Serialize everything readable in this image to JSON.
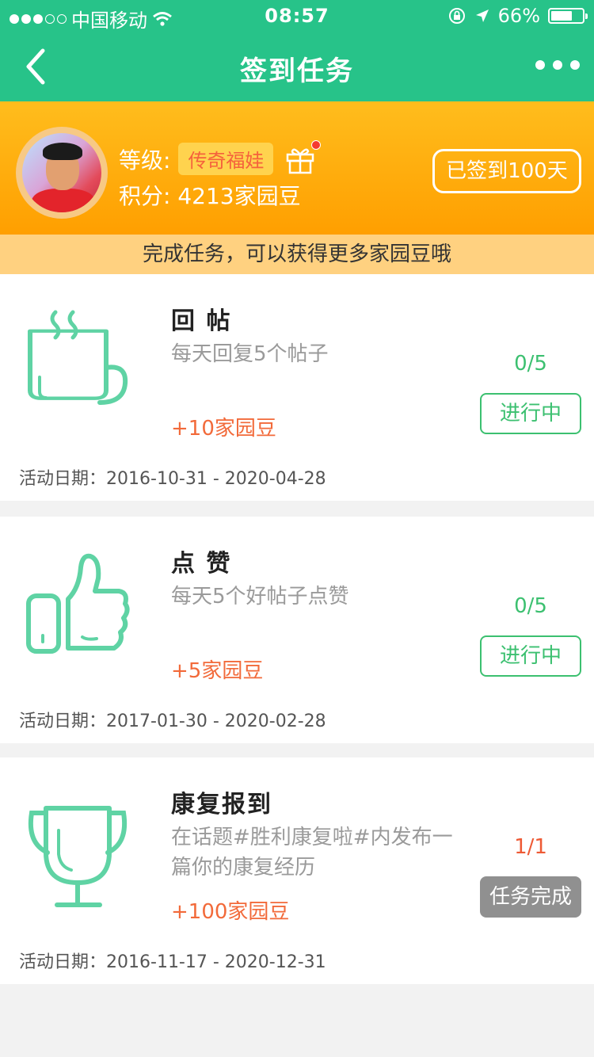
{
  "status_bar": {
    "carrier": "中国移动",
    "time": "08:57",
    "battery": "66%"
  },
  "nav": {
    "title": "签到任务"
  },
  "profile": {
    "level_label": "等级:",
    "level_value": "传奇福娃",
    "points_label": "积分:",
    "points_value": "4213家园豆",
    "signin_label": "已签到100天"
  },
  "banner": {
    "text": "完成任务，可以获得更多家园豆哦"
  },
  "tasks": [
    {
      "icon": "coffee-cup-icon",
      "name": "回 帖",
      "desc": "每天回复5个帖子",
      "reward": "+10家园豆",
      "progress": "0/5",
      "status": "进行中",
      "date_label": "活动日期：",
      "date_range": "2016-10-31 - 2020-04-28"
    },
    {
      "icon": "thumbs-up-icon",
      "name": "点 赞",
      "desc": "每天5个好帖子点赞",
      "reward": "+5家园豆",
      "progress": "0/5",
      "status": "进行中",
      "date_label": "活动日期：",
      "date_range": "2017-01-30 - 2020-02-28"
    },
    {
      "icon": "trophy-icon",
      "name": "康复报到",
      "desc": "在话题#胜利康复啦#内发布一篇你的康复经历",
      "reward": "+100家园豆",
      "progress": "1/1",
      "status": "任务完成",
      "date_label": "活动日期：",
      "date_range": "2016-11-17 - 2020-12-31"
    }
  ],
  "colors": {
    "brand_green": "#27c389",
    "icon_green": "#5fd3a4",
    "accent_orange": "#ffa800",
    "reward_orange": "#f26a3a"
  }
}
